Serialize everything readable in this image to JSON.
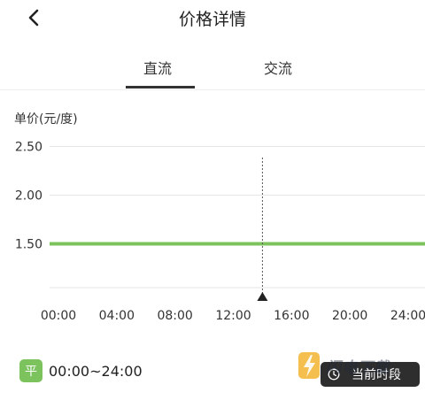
{
  "header": {
    "title": "价格详情"
  },
  "tabs": [
    {
      "label": "直流",
      "selected": true
    },
    {
      "label": "交流",
      "selected": false
    }
  ],
  "chart": {
    "unit_label": "单价(元/度)"
  },
  "chart_data": {
    "type": "line",
    "x": [
      "00:00",
      "04:00",
      "08:00",
      "12:00",
      "16:00",
      "20:00",
      "24:00"
    ],
    "series": [
      {
        "values": [
          1.5,
          1.5,
          1.5,
          1.5,
          1.5,
          1.5,
          1.5
        ],
        "color": "#7cc35d"
      }
    ],
    "y_ticks": [
      2.5,
      2.0,
      1.5
    ],
    "y_tick_labels": [
      "2.50",
      "2.00",
      "1.50"
    ],
    "ylim": [
      1.05,
      2.55
    ],
    "xlim": [
      "00:00",
      "24:00"
    ],
    "current_time": "14:00",
    "grid": true
  },
  "legend": {
    "badge": "平",
    "time_range": "00:00~24:00"
  },
  "current_period_button": {
    "label": "当前时段"
  },
  "watermark": {
    "text": "闪电下载"
  },
  "colors": {
    "accent_green": "#7cc35d",
    "button_dark": "#2e2e2e",
    "grid": "#e6e6e6"
  }
}
